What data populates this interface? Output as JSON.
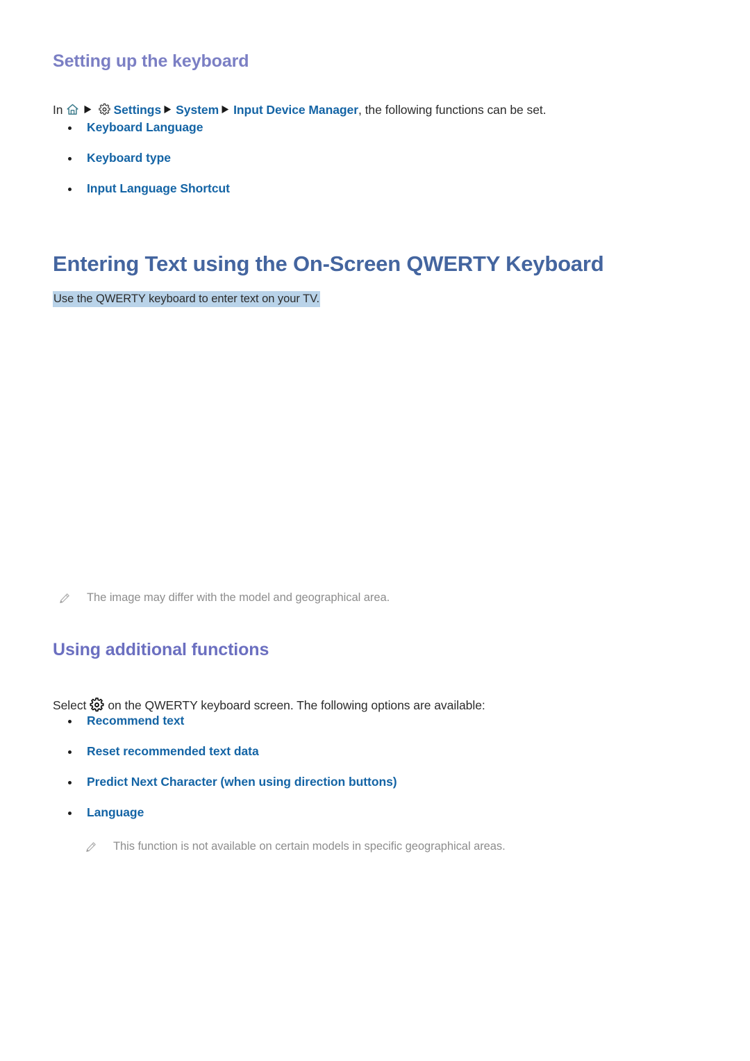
{
  "document": {
    "sub_heading": "Setting up the keyboard",
    "chapter_title": "Entering Text using the On-Screen QWERTY Keyboard",
    "section_heading": "Using additional functions"
  },
  "path_line": {
    "prefix": "In",
    "home_icon": "home-icon",
    "arrow_icon_1": "arrow-right-icon",
    "gear_icon": "gear-icon",
    "settings": "Settings",
    "arrow_icon_2": "arrow-right-icon",
    "system": "System",
    "arrow_icon_3": "arrow-right-icon",
    "input_device_manager": "Input Device Manager",
    "suffix": ", the following functions can be set."
  },
  "keyboard_options": [
    {
      "label": "Keyboard Language"
    },
    {
      "label": "Keyboard type"
    },
    {
      "label": "Input Language Shortcut"
    }
  ],
  "highlighted_text": "Use the QWERTY keyboard to enter text on your TV.",
  "note_image": {
    "icon": "pencil-icon",
    "text": "The image may differ with the model and geographical area."
  },
  "select_line": {
    "prefix": "Select",
    "gear_icon": "gear-icon",
    "suffix": "on the QWERTY keyboard screen. The following options are available:"
  },
  "additional_options": [
    {
      "label": "Recommend text"
    },
    {
      "label": "Reset recommended text data"
    },
    {
      "label": "Predict Next Character (when using direction buttons)"
    },
    {
      "label": "Language"
    }
  ],
  "note_function": {
    "icon": "pencil-icon",
    "text": "This function is not available on certain models in specific geographical areas."
  },
  "colors": {
    "sub_heading": "#7b7fc4",
    "chapter_title": "#44659f",
    "section_heading": "#6b6fc0",
    "link": "#1464a5",
    "body_text": "#2b2b2b",
    "note_text": "#8d8d8d",
    "highlight_bg": "#b9d3e9",
    "home_icon": "#3d7c8c",
    "page_bg": "#ffffff"
  }
}
